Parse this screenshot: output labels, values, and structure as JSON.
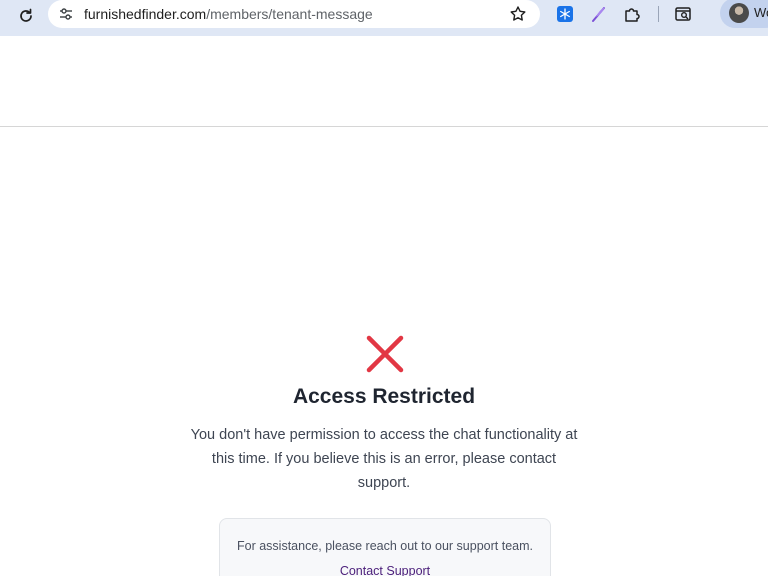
{
  "browser": {
    "url_host": "furnishedfinder.com",
    "url_path": "/members/tenant-message",
    "profile_name": "Wo",
    "icons": {
      "reload": "reload-icon",
      "site_info": "tune-icon",
      "bookmark": "star-icon",
      "extensions": [
        "snowflake-extension-icon",
        "feather-extension-icon",
        "puzzle-icon"
      ],
      "tab_search": "tab-search-icon",
      "avatar": "avatar"
    }
  },
  "main": {
    "status_icon": "close-x-icon",
    "status_color": "#e23744",
    "title": "Access Restricted",
    "message": "You don't have permission to access the chat functionality at this time. If you believe this is an error, please contact support.",
    "assistance_text": "For assistance, please reach out to our support team.",
    "support_link": "Contact Support",
    "link_color": "#4b1f7a"
  }
}
